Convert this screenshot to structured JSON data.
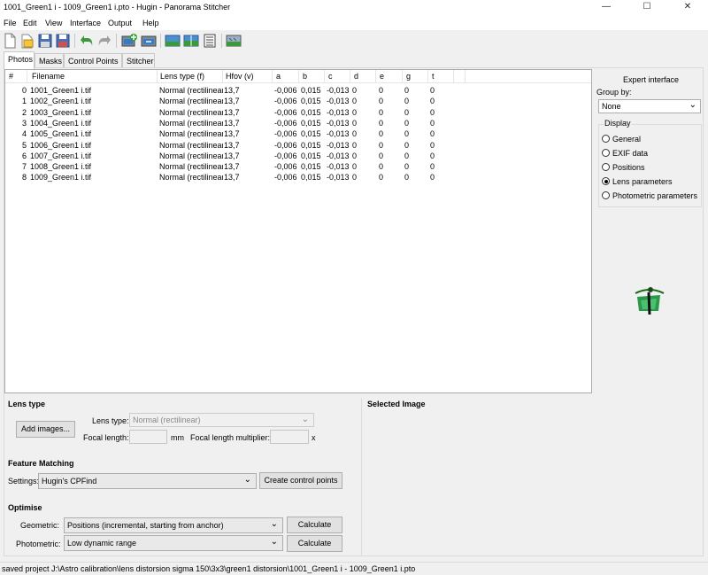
{
  "window": {
    "title": "1001_Green1 i - 1009_Green1 i.pto - Hugin - Panorama Stitcher",
    "minimize": "—",
    "maximize": "☐",
    "close": "✕"
  },
  "menu": [
    "File",
    "Edit",
    "View",
    "Interface",
    "Output",
    "Help"
  ],
  "toolbar": [
    "new-icon",
    "open-icon",
    "save-icon",
    "save-as-icon",
    "undo-icon",
    "redo-icon",
    "add-images-icon",
    "add-series-icon",
    "preview-icon",
    "fast-preview-icon",
    "control-points-icon",
    "layout-icon"
  ],
  "tabs": [
    "Photos",
    "Masks",
    "Control Points",
    "Stitcher"
  ],
  "table": {
    "columns": [
      "#",
      "Filename",
      "Lens type (f)",
      "Hfov (v)",
      "a",
      "b",
      "c",
      "d",
      "e",
      "g",
      "t"
    ],
    "rows": [
      [
        "0",
        "1001_Green1 i.tif",
        "Normal (rectilinear)",
        "13,7",
        "-0,006",
        "0,015",
        "-0,013",
        "0",
        "0",
        "0",
        "0"
      ],
      [
        "1",
        "1002_Green1 i.tif",
        "Normal (rectilinear)",
        "13,7",
        "-0,006",
        "0,015",
        "-0,013",
        "0",
        "0",
        "0",
        "0"
      ],
      [
        "2",
        "1003_Green1 i.tif",
        "Normal (rectilinear)",
        "13,7",
        "-0,006",
        "0,015",
        "-0,013",
        "0",
        "0",
        "0",
        "0"
      ],
      [
        "3",
        "1004_Green1 i.tif",
        "Normal (rectilinear)",
        "13,7",
        "-0,006",
        "0,015",
        "-0,013",
        "0",
        "0",
        "0",
        "0"
      ],
      [
        "4",
        "1005_Green1 i.tif",
        "Normal (rectilinear)",
        "13,7",
        "-0,006",
        "0,015",
        "-0,013",
        "0",
        "0",
        "0",
        "0"
      ],
      [
        "5",
        "1006_Green1 i.tif",
        "Normal (rectilinear)",
        "13,7",
        "-0,006",
        "0,015",
        "-0,013",
        "0",
        "0",
        "0",
        "0"
      ],
      [
        "6",
        "1007_Green1 i.tif",
        "Normal (rectilinear)",
        "13,7",
        "-0,006",
        "0,015",
        "-0,013",
        "0",
        "0",
        "0",
        "0"
      ],
      [
        "7",
        "1008_Green1 i.tif",
        "Normal (rectilinear)",
        "13,7",
        "-0,006",
        "0,015",
        "-0,013",
        "0",
        "0",
        "0",
        "0"
      ],
      [
        "8",
        "1009_Green1 i.tif",
        "Normal (rectilinear)",
        "13,7",
        "-0,006",
        "0,015",
        "-0,013",
        "0",
        "0",
        "0",
        "0"
      ]
    ]
  },
  "side": {
    "expert_interface": "Expert interface",
    "group_by_label": "Group by:",
    "group_by_value": "None",
    "display_label": "Display",
    "radios": [
      "General",
      "EXIF data",
      "Positions",
      "Lens parameters",
      "Photometric parameters"
    ],
    "selected_radio": "Lens parameters"
  },
  "lens": {
    "section": "Lens type",
    "add_images": "Add images...",
    "lens_type_label": "Lens type:",
    "lens_type_value": "Normal (rectilinear)",
    "focal_length_label": "Focal length:",
    "focal_unit": "mm",
    "multiplier_label": "Focal length multiplier:",
    "multiplier_unit": "x"
  },
  "selected_image": "Selected Image",
  "feature": {
    "section": "Feature Matching",
    "settings_label": "Settings:",
    "settings_value": "Hugin's CPFind",
    "create_button": "Create control points"
  },
  "optimise": {
    "section": "Optimise",
    "geometric_label": "Geometric:",
    "geometric_value": "Positions (incremental, starting from anchor)",
    "photometric_label": "Photometric:",
    "photometric_value": "Low dynamic range",
    "calculate": "Calculate"
  },
  "status": "saved project J:\\Astro calibration\\lens distorsion sigma 150\\3x3\\green1 distorsion\\1001_Green1 i - 1009_Green1 i.pto"
}
